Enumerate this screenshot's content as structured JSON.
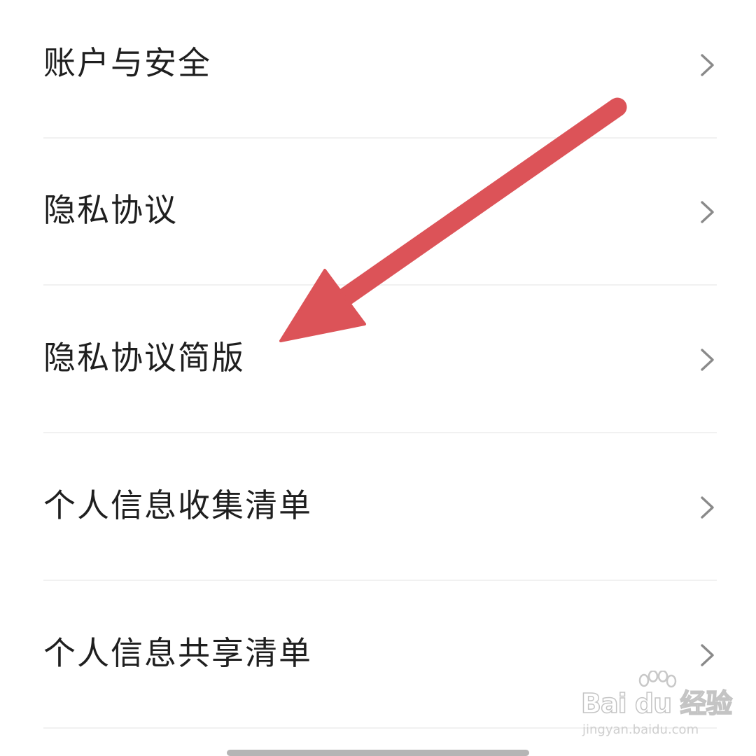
{
  "settings_menu": {
    "items": [
      {
        "label": "账户与安全",
        "icon": "chevron-right-icon"
      },
      {
        "label": "隐私协议",
        "icon": "chevron-right-icon"
      },
      {
        "label": "隐私协议简版",
        "icon": "chevron-right-icon"
      },
      {
        "label": "个人信息收集清单",
        "icon": "chevron-right-icon"
      },
      {
        "label": "个人信息共享清单",
        "icon": "chevron-right-icon"
      }
    ]
  },
  "annotation": {
    "type": "arrow",
    "color": "#dc5358",
    "points_to": "隐私协议简版"
  },
  "watermark": {
    "brand": "Bai du 经验",
    "url": "jingyan.baidu.com"
  },
  "colors": {
    "background": "#ffffff",
    "text": "#1f1f1f",
    "chevron": "#8a8a8a",
    "divider": "#f1f1f1",
    "arrow": "#dc5358"
  }
}
